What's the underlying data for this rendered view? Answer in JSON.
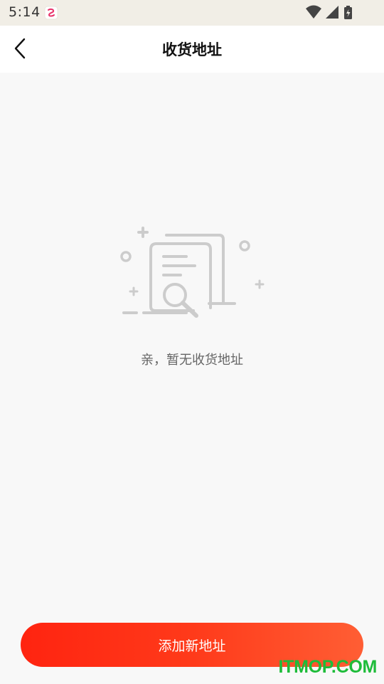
{
  "status_bar": {
    "time": "5:14",
    "app_icon": "app-notification-icon",
    "indicators": [
      "wifi-icon",
      "cellular-signal-icon",
      "battery-charging-icon"
    ]
  },
  "header": {
    "title": "收货地址",
    "back_icon": "back-arrow-icon"
  },
  "empty_state": {
    "illustration": "document-search-icon",
    "message": "亲，暂无收货地址"
  },
  "actions": {
    "add_label": "添加新地址"
  },
  "watermark": "ITMOP.COM",
  "colors": {
    "status_bar_bg": "#f1eee6",
    "page_bg": "#f8f8f8",
    "button_gradient_start": "#ff2410",
    "button_gradient_end": "#ff5e34",
    "illustration_gray": "#cccccc",
    "watermark_green": "#1ebc3a"
  }
}
